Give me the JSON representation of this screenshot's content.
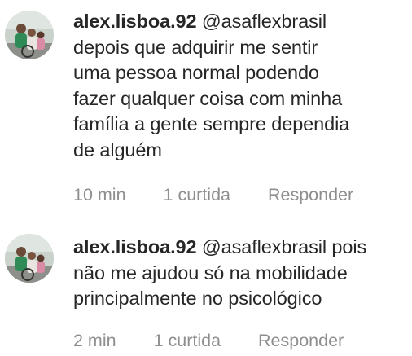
{
  "comments": [
    {
      "username": "alex.lisboa.92",
      "mention": "@asaflexbrasil",
      "lines": [
        "depois que adquirir me sentir",
        "uma pessoa normal podendo",
        "fazer qualquer coisa com minha",
        "família a gente sempre dependia",
        "de alguém"
      ],
      "time": "10 min",
      "likes": "1 curtida",
      "reply_label": "Responder"
    },
    {
      "username": "alex.lisboa.92",
      "mention": "@asaflexbrasil",
      "first_line_tail": "pois",
      "lines": [
        "não me ajudou só na mobilidade",
        "principalmente no psicológico"
      ],
      "time": "2 min",
      "likes": "1 curtida",
      "reply_label": "Responder"
    }
  ],
  "colors": {
    "text": "#262626",
    "meta": "#8e8e8e",
    "background": "#ffffff"
  }
}
